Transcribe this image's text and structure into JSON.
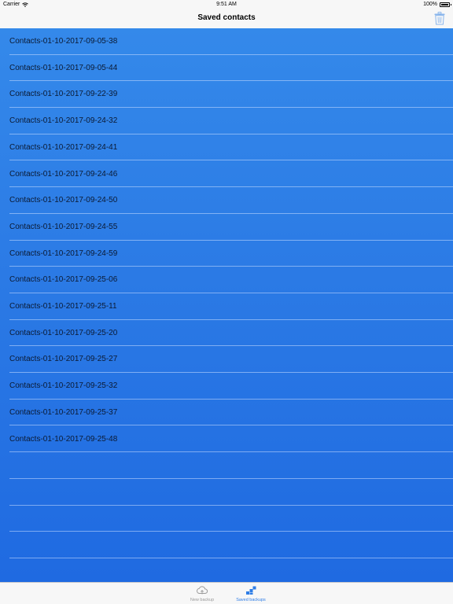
{
  "status_bar": {
    "carrier": "Carrier",
    "time": "9:51 AM",
    "battery": "100%"
  },
  "nav": {
    "title": "Saved contacts",
    "trash_icon": "trash-icon",
    "accent_color": "#8ab6ec"
  },
  "list": {
    "items": [
      "Contacts-01-10-2017-09-05-38",
      "Contacts-01-10-2017-09-05-44",
      "Contacts-01-10-2017-09-22-39",
      "Contacts-01-10-2017-09-24-32",
      "Contacts-01-10-2017-09-24-41",
      "Contacts-01-10-2017-09-24-46",
      "Contacts-01-10-2017-09-24-50",
      "Contacts-01-10-2017-09-24-55",
      "Contacts-01-10-2017-09-24-59",
      "Contacts-01-10-2017-09-25-06",
      "Contacts-01-10-2017-09-25-11",
      "Contacts-01-10-2017-09-25-20",
      "Contacts-01-10-2017-09-25-27",
      "Contacts-01-10-2017-09-25-32",
      "Contacts-01-10-2017-09-25-37",
      "Contacts-01-10-2017-09-25-48",
      "",
      "",
      "",
      "",
      ""
    ],
    "background_top": "#3489ea",
    "background_bottom": "#1f6ae1"
  },
  "tabs": [
    {
      "label": "New backup",
      "icon": "cloud-icon",
      "selected": false
    },
    {
      "label": "Saved backups",
      "icon": "stack-icon",
      "selected": true
    }
  ],
  "colors": {
    "tab_selected": "#2e7de6",
    "tab_unselected": "#9a9a9a"
  }
}
